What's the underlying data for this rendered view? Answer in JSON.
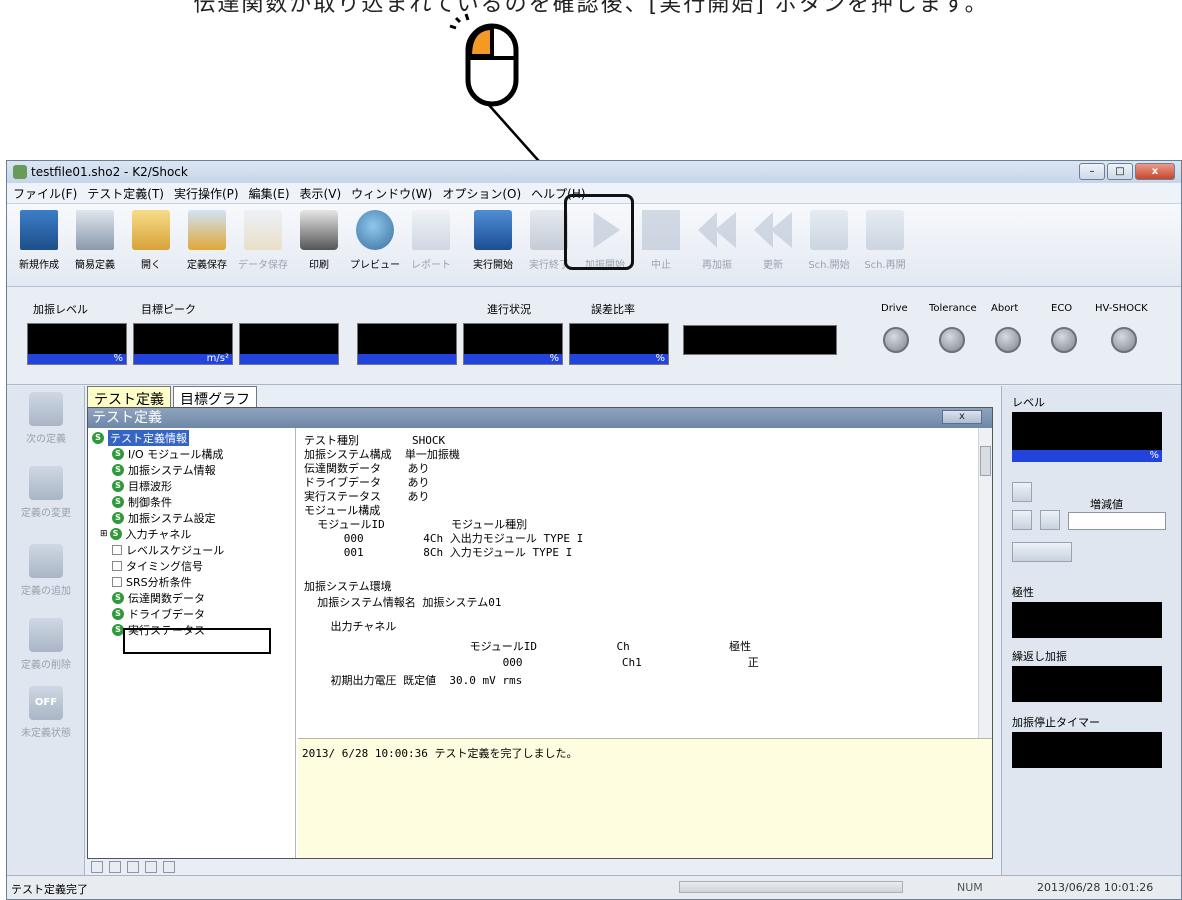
{
  "caption": "伝達関数が取り込まれているのを確認後、[実行開始] ボタンを押します。",
  "window": {
    "title": "testfile01.sho2 - K2/Shock",
    "controls": [
      "–",
      "□",
      "x"
    ]
  },
  "menu": [
    "ファイル(F)",
    "テスト定義(T)",
    "実行操作(P)",
    "編集(E)",
    "表示(V)",
    "ウィンドウ(W)",
    "オプション(O)",
    "ヘルプ(H)"
  ],
  "toolbar": [
    {
      "label": "新規作成",
      "icon": "new-document-icon",
      "enabled": true
    },
    {
      "label": "簡易定義",
      "icon": "simple-definition-icon",
      "enabled": true
    },
    {
      "label": "開く",
      "icon": "open-folder-icon",
      "enabled": true
    },
    {
      "label": "定義保存",
      "icon": "save-definition-icon",
      "enabled": true
    },
    {
      "label": "データ保存",
      "icon": "save-data-icon",
      "enabled": false
    },
    {
      "label": "印刷",
      "icon": "printer-icon",
      "enabled": true
    },
    {
      "label": "プレビュー",
      "icon": "preview-icon",
      "enabled": true
    },
    {
      "label": "レポート",
      "icon": "word-report-icon",
      "enabled": false
    },
    {
      "label": "実行開始",
      "icon": "run-start-icon",
      "enabled": true
    },
    {
      "label": "実行終了",
      "icon": "run-stop-icon",
      "enabled": false
    },
    {
      "label": "加振開始",
      "icon": "play-icon",
      "enabled": false
    },
    {
      "label": "中止",
      "icon": "stop-icon",
      "enabled": false
    },
    {
      "label": "再加振",
      "icon": "rewind-icon",
      "enabled": false
    },
    {
      "label": "更新",
      "icon": "update-icon",
      "enabled": false
    },
    {
      "label": "Sch.開始",
      "icon": "schedule-start-icon",
      "enabled": false
    },
    {
      "label": "Sch.再開",
      "icon": "schedule-resume-icon",
      "enabled": false
    }
  ],
  "meters": {
    "labels": [
      "加振レベル",
      "目標ピーク",
      "進行状況",
      "誤差比率"
    ],
    "units": [
      "%",
      "m/s²",
      "%",
      "%"
    ],
    "indicators": [
      "Drive",
      "Tolerance",
      "Abort",
      "ECO",
      "HV-SHOCK"
    ]
  },
  "leftbar": [
    "次の定義",
    "定義の変更",
    "定義の追加",
    "定義の削除",
    "未定義状態"
  ],
  "leftbar_off": "OFF",
  "tabs": [
    "テスト定義",
    "目標グラフ"
  ],
  "panel_title": "テスト定義",
  "panel_close": "x",
  "tree": [
    {
      "label": "テスト定義情報",
      "type": "s",
      "selected": true
    },
    {
      "label": "I/O モジュール構成",
      "type": "s"
    },
    {
      "label": "加振システム情報",
      "type": "s"
    },
    {
      "label": "目標波形",
      "type": "s"
    },
    {
      "label": "制御条件",
      "type": "s"
    },
    {
      "label": "加振システム設定",
      "type": "s"
    },
    {
      "label": "入力チャネル",
      "type": "s"
    },
    {
      "label": "レベルスケジュール",
      "type": "box"
    },
    {
      "label": "タイミング信号",
      "type": "box"
    },
    {
      "label": "SRS分析条件",
      "type": "box"
    },
    {
      "label": "伝達関数データ",
      "type": "s"
    },
    {
      "label": "ドライブデータ",
      "type": "s"
    },
    {
      "label": "実行ステータス",
      "type": "s"
    }
  ],
  "content": [
    "テスト種別        SHOCK",
    "加振システム構成  単一加振機",
    "伝達関数データ    あり",
    "ドライブデータ    あり",
    "実行ステータス    あり",
    "モジュール構成",
    "  モジュールID          モジュール種別",
    "      000         4Ch 入出力モジュール TYPE I",
    "      001         8Ch 入力モジュール TYPE I",
    "",
    "加振システム環境",
    "  加振システム情報名 加振システム01",
    "",
    "    出力チャネル",
    "                         モジュールID            Ch               極性",
    "                              000               Ch1                正",
    "    初期出力電圧 既定値  30.0 mV rms"
  ],
  "log": "2013/ 6/28 10:00:36 テスト定義を完了しました。",
  "rightpanel": {
    "level_label": "レベル",
    "level_unit": "%",
    "step_label": "増減値",
    "polarity_label": "極性",
    "repeat_label": "繰返し加振",
    "timer_label": "加振停止タイマー"
  },
  "status": {
    "left": "テスト定義完了",
    "num": "NUM",
    "datetime": "2013/06/28  10:01:26"
  }
}
